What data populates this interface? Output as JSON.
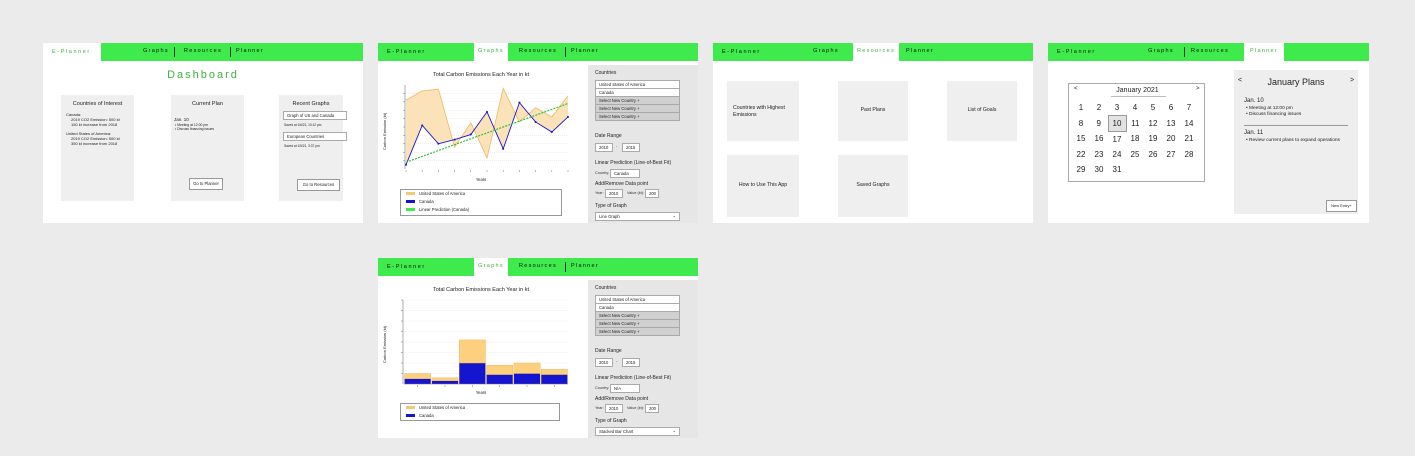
{
  "nav": {
    "brand": "E-Planner",
    "graphs": "Graphs",
    "resources": "Resources",
    "planner": "Planner"
  },
  "dashboard": {
    "title": "Dashboard",
    "interest": {
      "title": "Countries of Interest",
      "lines": [
        "Canada:",
        "2019 CO2 Emission: 500 kt",
        "150 kt increase from 2018",
        "",
        "United States of America:",
        "2019 CO2 Emission: 500 kt",
        "350 kt increase from 2018"
      ]
    },
    "plan": {
      "title": "Current Plan",
      "date": "Jan. 10",
      "items": [
        "• Meeting at 12:00 pm",
        "• Discuss financing issues"
      ],
      "button": "Go to Planner"
    },
    "recent": {
      "title": "Recent Graphs",
      "graphs": [
        {
          "name": "Graph of US and Canada",
          "saved": "Saved at 1/6/21, 10:12 pm"
        },
        {
          "name": "European Countries",
          "saved": "Saved at 1/5/21, 3:37 pm"
        }
      ],
      "button": "Go to Resources"
    }
  },
  "graph_sidebar": {
    "countries_label": "Countries",
    "countries": [
      "United States of America",
      "Canada",
      "Select New Country +",
      "Select New Country +",
      "Select New Country +"
    ],
    "date_range_label": "Date Range",
    "date_from": "2010",
    "date_sep": "-",
    "date_to": "2015",
    "prediction_label": "Linear Prediction (Line-of-Best Fit)",
    "country_label": "Country:",
    "add_label": "Add/Remove Data point",
    "year_label": "Year:",
    "year_value": "2010",
    "value_label": "Value (kt):",
    "value_value": "200",
    "type_label": "Type of Graph",
    "chevron": "⌄"
  },
  "line_view": {
    "prediction_country": "Canada",
    "graph_type": "Line Graph"
  },
  "bar_view": {
    "prediction_country": "N/A",
    "graph_type": "Stacked Bar Chart"
  },
  "chart_data": [
    {
      "type": "line",
      "title": "Total Carbon Emissions Each Year in kt",
      "xlabel": "Years",
      "ylabel": "Carbon Emission (kt)",
      "x": [
        0,
        1,
        2,
        3,
        4,
        5,
        6,
        7,
        8,
        9,
        10
      ],
      "series": [
        {
          "name": "United States of America",
          "values": [
            8.2,
            9.3,
            9.5,
            2.6,
            5.5,
            1.3,
            9.6,
            5.6,
            7.3,
            6.2,
            8.7
          ]
        },
        {
          "name": "Canada",
          "values": [
            0.5,
            5.2,
            3.0,
            3.5,
            4.1,
            6.8,
            2.4,
            7.9,
            5.6,
            4.4,
            6.2
          ]
        },
        {
          "name": "Linear Prediction (Canada)",
          "values": [
            0.8,
            1.5,
            2.2,
            2.9,
            3.6,
            4.3,
            5.0,
            5.7,
            6.4,
            7.1,
            7.8
          ]
        }
      ],
      "ylim": [
        0,
        10
      ]
    },
    {
      "type": "bar",
      "title": "Total Carbon Emissions Each Year in kt",
      "xlabel": "Years",
      "ylabel": "Carbon Emission (kt)",
      "categories": [
        "1",
        "2",
        "3",
        "4",
        "5",
        "6"
      ],
      "series": [
        {
          "name": "Canada",
          "values": [
            0.5,
            0.3,
            2.0,
            0.9,
            1.0,
            0.9
          ]
        },
        {
          "name": "United States of America",
          "values": [
            0.5,
            0.3,
            2.2,
            0.9,
            1.0,
            0.5
          ]
        }
      ],
      "ylim": [
        0,
        8
      ]
    }
  ],
  "resources": {
    "cards": [
      "Countries with Highest Emissions",
      "Past Plans",
      "List of Goals",
      "How to Use This App",
      "Saved Graphs"
    ]
  },
  "calendar": {
    "month": "January 2021",
    "prev": "<",
    "next": ">",
    "rows": [
      [
        "1",
        "2",
        "3",
        "4",
        "5",
        "6",
        "7"
      ],
      [
        "8",
        "9",
        "10",
        "11",
        "12",
        "13",
        "14"
      ],
      [
        "15",
        "16",
        "17",
        "18",
        "19",
        "20",
        "21"
      ],
      [
        "22",
        "23",
        "24",
        "25",
        "26",
        "27",
        "28"
      ],
      [
        "29",
        "30",
        "31",
        "",
        "",
        "",
        ""
      ]
    ]
  },
  "plans": {
    "title": "January Plans",
    "prev": "<",
    "next": ">",
    "entries": [
      {
        "date": "Jan. 10",
        "items": [
          "• Meeting at 12:00 pm",
          "• Discuss financing issues"
        ]
      },
      {
        "date": "Jan. 11",
        "items": [
          "• Review current plans to expand operations"
        ]
      }
    ],
    "new_entry": "New Entry+"
  }
}
